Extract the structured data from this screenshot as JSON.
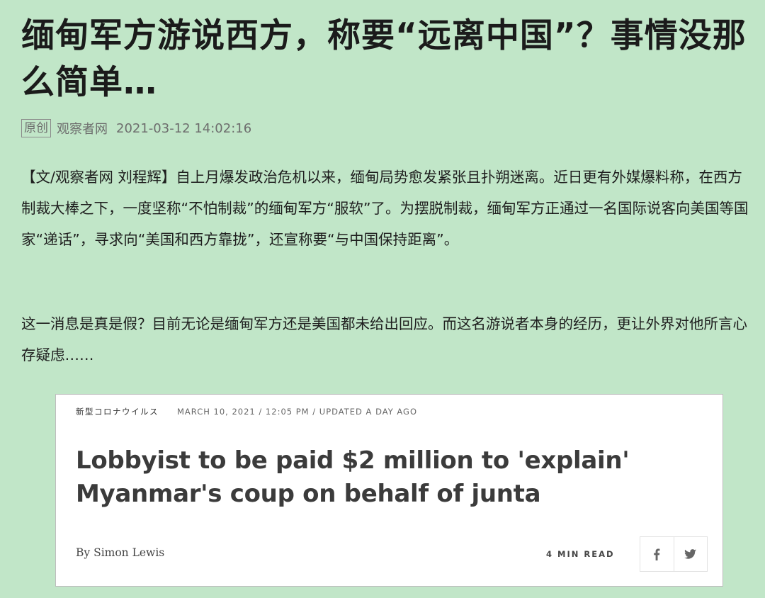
{
  "article": {
    "title": "缅甸军方游说西方，称要“远离中国”？事情没那么简单…",
    "badge": "原创",
    "source": "观察者网",
    "datetime": "2021-03-12 14:02:16",
    "paragraphs": [
      "【文/观察者网 刘程辉】自上月爆发政治危机以来，缅甸局势愈发紧张且扑朔迷离。近日更有外媒爆料称，在西方制裁大棒之下，一度坚称“不怕制裁”的缅甸军方“服软”了。为摆脱制裁，缅甸军方正通过一名国际说客向美国等国家“递话”，寻求向“美国和西方靠拢”，还宣称要“与中国保持距离”。",
      "这一消息是真是假？目前无论是缅甸军方还是美国都未给出回应。而这名游说者本身的经历，更让外界对他所言心存疑虑……"
    ]
  },
  "card": {
    "category": "新型コロナウイルス",
    "date": "MARCH 10, 2021 / 12:05 PM / UPDATED A DAY AGO",
    "headline": "Lobbyist to be paid $2 million to 'explain' Myanmar's coup on behalf of junta",
    "byline": "By Simon Lewis",
    "read_time": "4 MIN READ",
    "share_icons": [
      "facebook-icon",
      "twitter-icon"
    ]
  }
}
